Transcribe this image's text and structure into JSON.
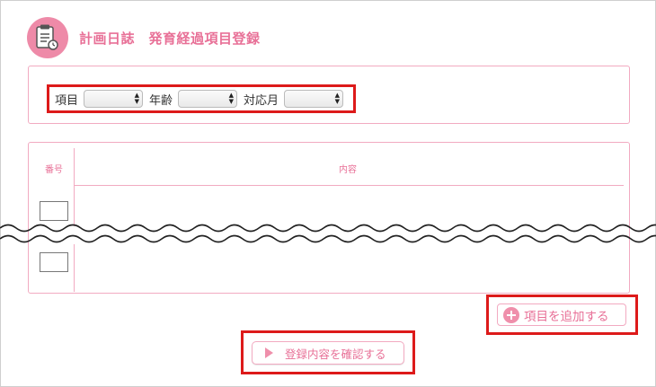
{
  "header": {
    "icon": "clipboard-icon",
    "title": "計画日誌　発育経過項目登録"
  },
  "filters": [
    {
      "label": "項目",
      "value": ""
    },
    {
      "label": "年齢",
      "value": ""
    },
    {
      "label": "対応月",
      "value": ""
    }
  ],
  "table": {
    "columns": [
      "番号",
      "内容"
    ]
  },
  "actions": {
    "add_item": "項目を追加する",
    "confirm": "登録内容を確認する"
  },
  "colors": {
    "accent": "#e87097",
    "border": "#f2aac1",
    "highlight": "#dd1a1a"
  }
}
